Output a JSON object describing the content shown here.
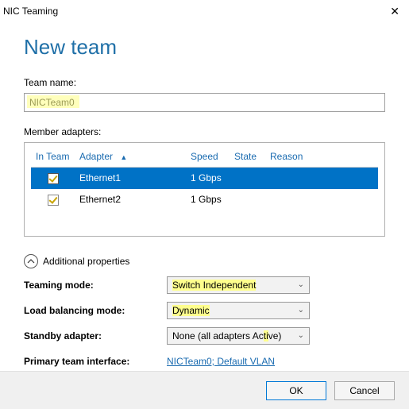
{
  "window": {
    "title": "NIC Teaming"
  },
  "page": {
    "heading": "New team"
  },
  "teamName": {
    "label": "Team name:",
    "value": "NICTeam0"
  },
  "memberAdapters": {
    "label": "Member adapters:",
    "columns": {
      "inTeam": "In Team",
      "adapter": "Adapter",
      "speed": "Speed",
      "state": "State",
      "reason": "Reason"
    },
    "rows": [
      {
        "checked": true,
        "selected": true,
        "adapter": "Ethernet1",
        "speed": "1 Gbps",
        "state": "",
        "reason": ""
      },
      {
        "checked": true,
        "selected": false,
        "adapter": "Ethernet2",
        "speed": "1 Gbps",
        "state": "",
        "reason": ""
      }
    ]
  },
  "additional": {
    "toggleLabel": "Additional properties",
    "teamingMode": {
      "label": "Teaming mode:",
      "value": "Switch Independent"
    },
    "loadBalancing": {
      "label": "Load balancing mode:",
      "value": "Dynamic"
    },
    "standby": {
      "label": "Standby adapter:",
      "value": "None (all adapters Active)"
    },
    "primaryIf": {
      "label": "Primary team interface:",
      "value": "NICTeam0; Default VLAN"
    }
  },
  "buttons": {
    "ok": "OK",
    "cancel": "Cancel"
  }
}
